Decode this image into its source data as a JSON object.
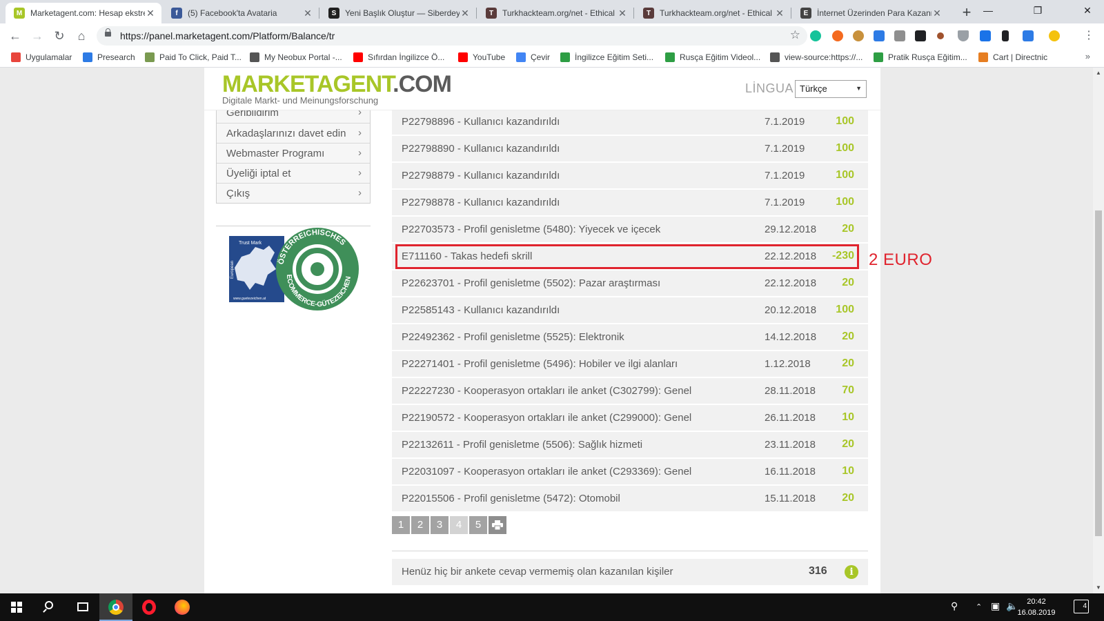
{
  "browser": {
    "tabs": [
      {
        "title": "Marketagent.com: Hesap ekstresi",
        "active": true,
        "favicon_color": "#a8c628",
        "favicon_glyph": "M"
      },
      {
        "title": "(5) Facebook'ta Avataria",
        "active": false,
        "favicon_color": "#3b5998",
        "favicon_glyph": "f"
      },
      {
        "title": "Yeni Başlık Oluştur — Siberdeyim",
        "active": false,
        "favicon_color": "#202020",
        "favicon_glyph": "S"
      },
      {
        "title": "Turkhackteam.org/net - Ethical",
        "active": false,
        "favicon_color": "#5a3b3b",
        "favicon_glyph": "T"
      },
      {
        "title": "Turkhackteam.org/net - Ethical",
        "active": false,
        "favicon_color": "#5a3b3b",
        "favicon_glyph": "T"
      },
      {
        "title": "İnternet Üzerinden Para Kazanma",
        "active": false,
        "favicon_color": "#444444",
        "favicon_glyph": "E"
      }
    ],
    "new_tab": "+",
    "window_controls": {
      "minimize": "—",
      "restore": "❐",
      "close": "✕"
    },
    "url": "https://panel.marketagent.com/Platform/Balance/tr",
    "bookmarks": [
      {
        "label": "Uygulamalar",
        "color": "#e8453c"
      },
      {
        "label": "Presearch",
        "color": "#2d7be5"
      },
      {
        "label": "Paid To Click, Paid T...",
        "color": "#7a9a50"
      },
      {
        "label": "My Neobux Portal -...",
        "color": "#555555"
      },
      {
        "label": "Sıfırdan İngilizce Ö...",
        "color": "#ff0000"
      },
      {
        "label": "YouTube",
        "color": "#ff0000"
      },
      {
        "label": "Çevir",
        "color": "#4285f4"
      },
      {
        "label": "İngilizce Eğitim Seti...",
        "color": "#2e9e44"
      },
      {
        "label": "Rusça Eğitim Videol...",
        "color": "#2e9e44"
      },
      {
        "label": "view-source:https://...",
        "color": "#555555"
      },
      {
        "label": "Pratik Rusça Eğitim...",
        "color": "#2e9e44"
      },
      {
        "label": "Cart | Directnic",
        "color": "#e67e22"
      }
    ],
    "bookmarks_more": "»"
  },
  "site": {
    "logo_main": "MARKETAGENT",
    "logo_dotcom": ".COM",
    "logo_sub": "Digitale Markt- und Meinungsforschung",
    "language_label": "LİNGUA",
    "language_value": "Türkçe",
    "brand_color": "#a8c628"
  },
  "sidebar": {
    "items": [
      {
        "label": "Geribildirim"
      },
      {
        "label": "Arkadaşlarınızı davet edin"
      },
      {
        "label": "Webmaster Programı"
      },
      {
        "label": "Üyeliği iptal et"
      },
      {
        "label": "Çıkış"
      }
    ],
    "seal": {
      "text_top": "ÖSTERREICHISCHES",
      "text_bottom": "ECOMMERCE-GÜTEZEICHEN",
      "badge_top": "Trust Mark",
      "badge_side": "European",
      "badge_url": "www.guetezeichen.at"
    }
  },
  "transactions": [
    {
      "desc": "P22798896 - Kullanıcı kazandırıldı",
      "date": "7.1.2019",
      "points": "100"
    },
    {
      "desc": "P22798890 - Kullanıcı kazandırıldı",
      "date": "7.1.2019",
      "points": "100"
    },
    {
      "desc": "P22798879 - Kullanıcı kazandırıldı",
      "date": "7.1.2019",
      "points": "100"
    },
    {
      "desc": "P22798878 - Kullanıcı kazandırıldı",
      "date": "7.1.2019",
      "points": "100"
    },
    {
      "desc": "P22703573 - Profil genisletme (5480): Yiyecek ve içecek",
      "date": "29.12.2018",
      "points": "20"
    },
    {
      "desc": "E711160 - Takas hedefi skrill",
      "date": "22.12.2018",
      "points": "-230"
    },
    {
      "desc": "P22623701 - Profil genisletme (5502): Pazar araştırması",
      "date": "22.12.2018",
      "points": "20"
    },
    {
      "desc": "P22585143 - Kullanıcı kazandırıldı",
      "date": "20.12.2018",
      "points": "100"
    },
    {
      "desc": "P22492362 - Profil genisletme (5525): Elektronik",
      "date": "14.12.2018",
      "points": "20"
    },
    {
      "desc": "P22271401 - Profil genisletme (5496): Hobiler ve ilgi alanları",
      "date": "1.12.2018",
      "points": "20"
    },
    {
      "desc": "P22227230 - Kooperasyon ortakları ile anket (C302799): Genel",
      "date": "28.11.2018",
      "points": "70"
    },
    {
      "desc": "P22190572 - Kooperasyon ortakları ile anket (C299000): Genel",
      "date": "26.11.2018",
      "points": "10"
    },
    {
      "desc": "P22132611 - Profil genisletme (5506): Sağlık hizmeti",
      "date": "23.11.2018",
      "points": "20"
    },
    {
      "desc": "P22031097 - Kooperasyon ortakları ile anket (C293369): Genel",
      "date": "16.11.2018",
      "points": "10"
    },
    {
      "desc": "P22015506 - Profil genisletme (5472): Otomobil",
      "date": "15.11.2018",
      "points": "20"
    }
  ],
  "annotation": {
    "text": "2 EURO",
    "color": "#e0242e"
  },
  "pagination": {
    "pages": [
      "1",
      "2",
      "3",
      "4",
      "5"
    ],
    "current": "4"
  },
  "summary": {
    "label": "Henüz hiç bir ankete cevap vermemiş olan kazanılan kişiler",
    "value": "316",
    "info_glyph": "i"
  },
  "taskbar": {
    "time": "20:42",
    "date": "16.08.2019",
    "notifications": "4"
  }
}
